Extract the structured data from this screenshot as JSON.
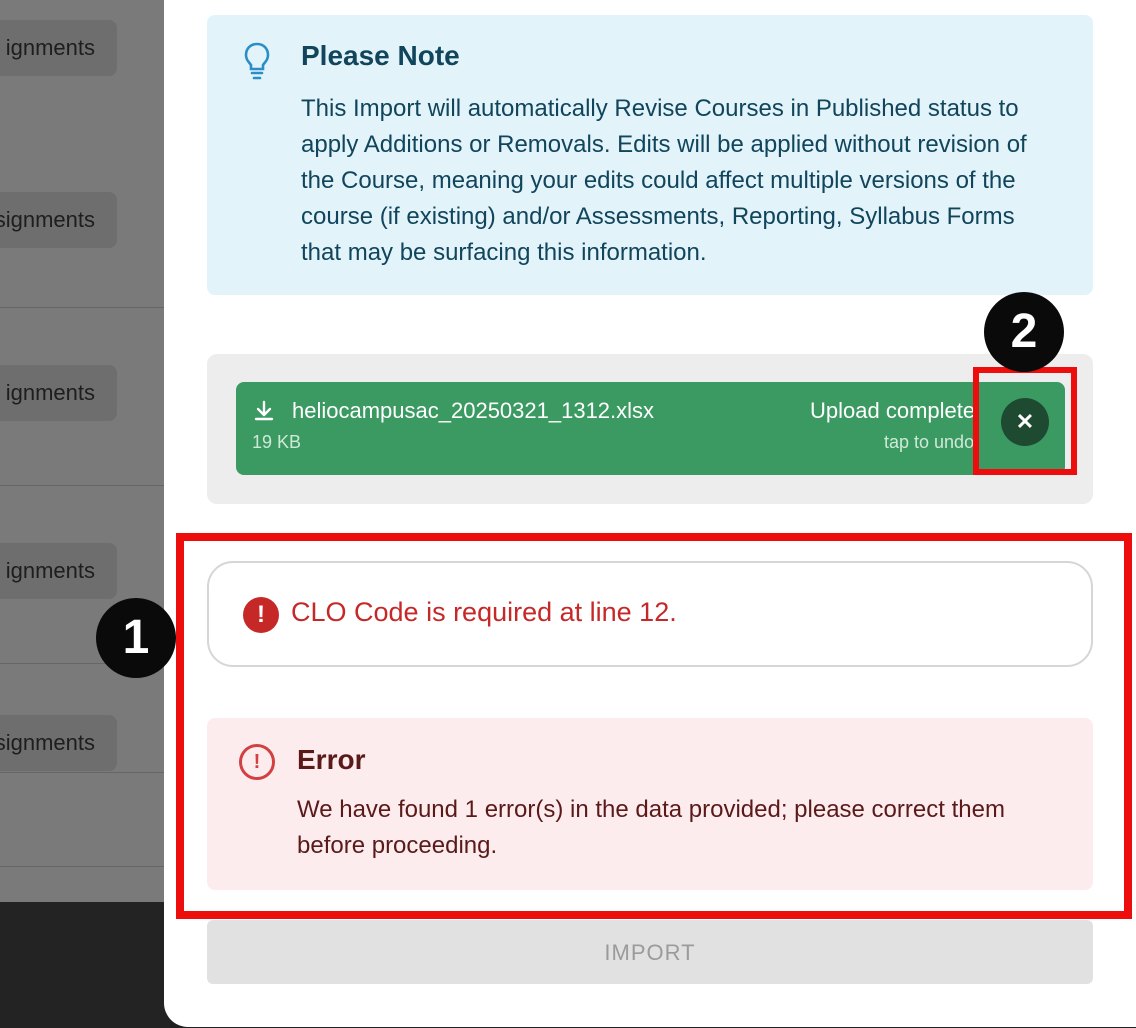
{
  "background": {
    "row_labels": [
      "ignments",
      "signments",
      "ignments",
      "ignments",
      "signments"
    ]
  },
  "note": {
    "icon": "lightbulb-icon",
    "title": "Please Note",
    "body": "This Import will automatically Revise Courses in Published status to apply Additions or Removals. Edits will be applied without revision of the Course, meaning your edits could affect multiple versions of the course (if existing) and/or Assessments, Reporting, Syllabus Forms that may be surfacing this information."
  },
  "upload": {
    "file_name": "heliocampusac_20250321_1312.xlsx",
    "file_size": "19 KB",
    "status": "Upload complete",
    "hint": "tap to undo",
    "undo_icon": "close-icon"
  },
  "validation": {
    "line_error": "CLO Code is required at line 12.",
    "error_title": "Error",
    "error_body": "We have found 1 error(s) in the data provided; please correct them before proceeding."
  },
  "actions": {
    "import_label": "IMPORT"
  },
  "annotations": {
    "badge_1": "1",
    "badge_2": "2",
    "highlight_color": "#ee0d0d"
  },
  "colors": {
    "upload_success": "#3a9a62",
    "error_red": "#c62828",
    "note_bg": "#e3f3fa"
  }
}
